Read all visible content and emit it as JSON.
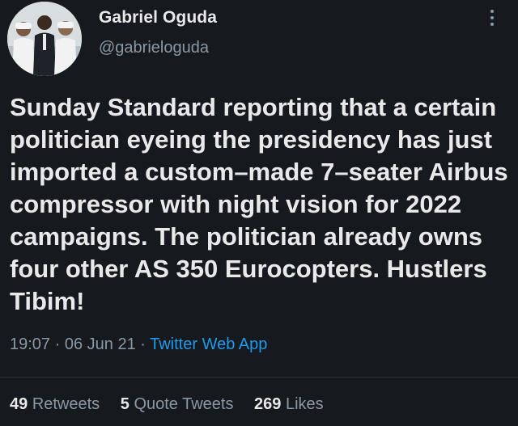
{
  "author": {
    "name": "Gabriel Oguda",
    "handle": "@gabrieloguda",
    "avatar": "group-photo-avatar"
  },
  "tweet": {
    "text": "Sunday Standard reporting that a certain politician eyeing the presidency has just imported a custom–made 7–seater Airbus compressor with night vision for 2022 campaigns. The politician already owns four other AS 350 Eurocopters. Hustlers Tibim!",
    "time": "19:07",
    "sep1": " · ",
    "date": "06 Jun 21",
    "sep2": " · ",
    "source": "Twitter Web App"
  },
  "stats": {
    "retweets_count": "49",
    "retweets_label": "Retweets",
    "quotes_count": "5",
    "quotes_label": "Quote Tweets",
    "likes_count": "269",
    "likes_label": "Likes"
  },
  "menu_icon": "more-vertical-icon",
  "colors": {
    "background": "#16191d",
    "text": "#e7e9ea",
    "secondary": "#8b98a5",
    "link": "#1d9bf0"
  }
}
